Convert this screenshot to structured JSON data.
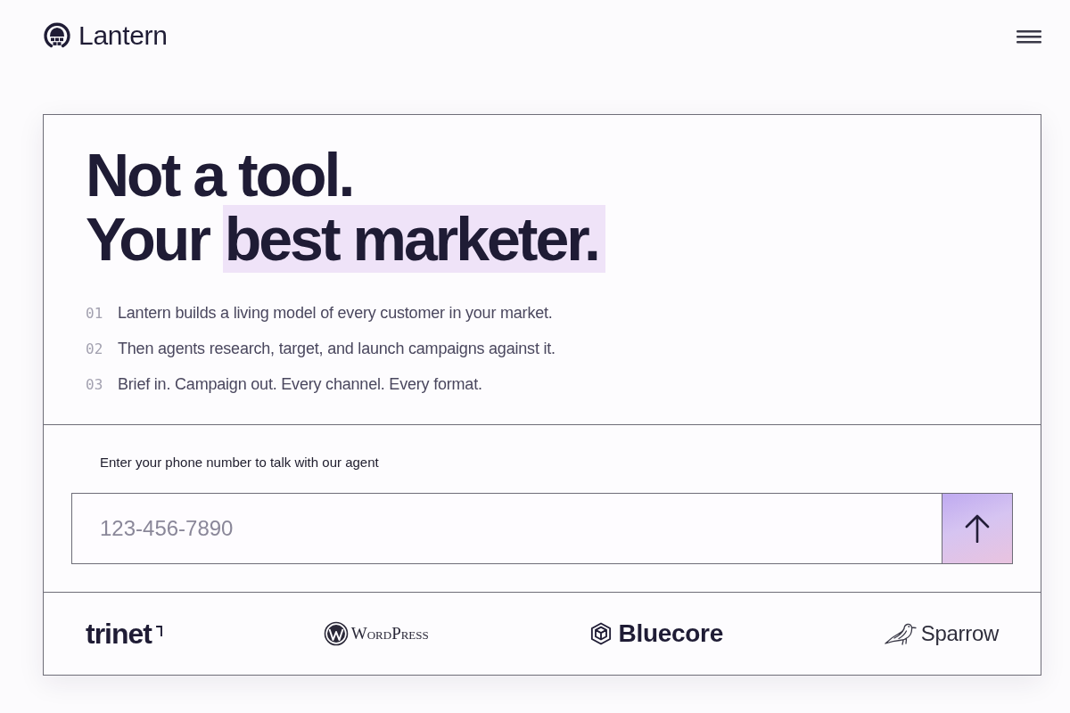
{
  "header": {
    "brand": "Lantern"
  },
  "hero": {
    "headline": {
      "line_1": "Not a tool.",
      "line_2_lead": "Your",
      "line_2_highlight": "best marketer."
    },
    "steps": [
      {
        "number": "01",
        "text": "Lantern builds a living model of every customer in your market."
      },
      {
        "number": "02",
        "text": "Then agents research, target, and launch campaigns against it."
      },
      {
        "number": "03",
        "text": "Brief in. Campaign out. Every channel. Every format."
      }
    ]
  },
  "phone_form": {
    "label": "Enter your phone number to talk with our agent",
    "placeholder": "123-456-7890"
  },
  "logos": [
    {
      "name": "trinet",
      "kind": "corner"
    },
    {
      "name": "WordPress",
      "kind": "emblem"
    },
    {
      "name": "Bluecore",
      "kind": "cube"
    },
    {
      "name": "Sparrow",
      "kind": "bird"
    }
  ]
}
